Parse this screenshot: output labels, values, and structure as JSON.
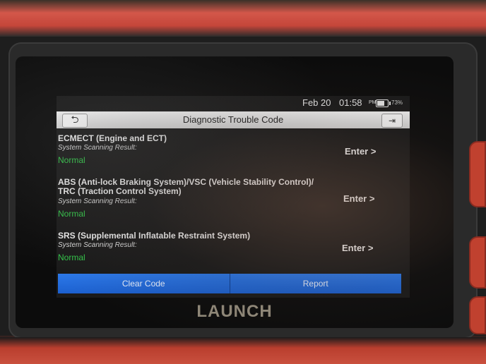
{
  "status": {
    "date": "Feb 20",
    "time": "01:58",
    "ampm": "PM",
    "battery": "73%"
  },
  "header": {
    "title": "Diagnostic Trouble Code",
    "back_icon": "back-arrow-icon",
    "exit_icon": "exit-icon"
  },
  "systems": [
    {
      "name": "ECMECT (Engine and ECT)",
      "result_label": "System Scanning Result:",
      "result": "Normal",
      "enter": "Enter >"
    },
    {
      "name_line1": "ABS (Anti-lock Braking System)/VSC (Vehicle Stability Control)/",
      "name_line2": "TRC (Traction Control System)",
      "result_label": "System Scanning Result:",
      "result": "Normal",
      "enter": "Enter >"
    },
    {
      "name": "SRS (Supplemental Inflatable Restraint System)",
      "result_label": "System Scanning Result:",
      "result": "Normal",
      "enter": "Enter >"
    }
  ],
  "footer": {
    "clear_code": "Clear Code",
    "report": "Report"
  },
  "brand": "LAUNCH",
  "colors": {
    "normal": "#33c94a",
    "button": "#1f6ad8",
    "casing": "#c24a38"
  }
}
